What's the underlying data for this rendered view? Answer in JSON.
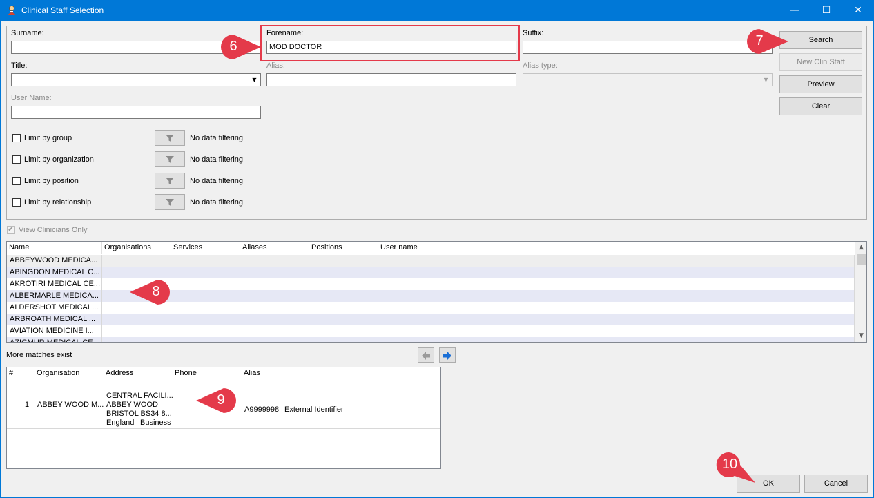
{
  "window": {
    "title": "Clinical Staff Selection",
    "minimize": "—",
    "maximize": "☐",
    "close": "✕"
  },
  "search_form": {
    "surname_label": "Surname:",
    "surname_value": "",
    "forename_label": "Forename:",
    "forename_value": "MOD DOCTOR",
    "suffix_label": "Suffix:",
    "suffix_value": "",
    "title_label": "Title:",
    "title_value": "",
    "alias_label": "Alias:",
    "alias_value": "",
    "alias_type_label": "Alias type:",
    "alias_type_value": "",
    "username_label": "User Name:",
    "username_value": "",
    "filters": [
      {
        "label": "Limit by group",
        "status": "No data filtering",
        "checked": false
      },
      {
        "label": "Limit by organization",
        "status": "No data filtering",
        "checked": false
      },
      {
        "label": "Limit by position",
        "status": "No data filtering",
        "checked": false
      },
      {
        "label": "Limit by relationship",
        "status": "No data filtering",
        "checked": false
      }
    ]
  },
  "buttons": {
    "search": "Search",
    "new_clin_staff": "New Clin Staff",
    "preview": "Preview",
    "clear": "Clear",
    "ok": "OK",
    "cancel": "Cancel"
  },
  "view_clinicians_only": {
    "label": "View Clinicians Only",
    "checked": true
  },
  "results_grid": {
    "columns": [
      "Name",
      "Organisations",
      "Services",
      "Aliases",
      "Positions",
      "User name"
    ],
    "rows": [
      [
        "ABBEYWOOD MEDICA...",
        "",
        "",
        "",
        "",
        ""
      ],
      [
        "ABINGDON MEDICAL C...",
        "",
        "",
        "",
        "",
        ""
      ],
      [
        "AKROTIRI MEDICAL CE...",
        "",
        "",
        "",
        "",
        ""
      ],
      [
        "ALBERMARLE MEDICA...",
        "",
        "",
        "",
        "",
        ""
      ],
      [
        "ALDERSHOT MEDICAL...",
        "",
        "",
        "",
        "",
        ""
      ],
      [
        "ARBROATH MEDICAL ...",
        "",
        "",
        "",
        "",
        ""
      ],
      [
        "AVIATION MEDICINE I...",
        "",
        "",
        "",
        "",
        ""
      ],
      [
        "AZIGMUR MEDICAL CE...",
        "",
        "",
        "",
        "",
        ""
      ]
    ]
  },
  "more_matches": "More matches exist",
  "detail_grid": {
    "columns": [
      "#",
      "Organisation",
      "Address",
      "Phone",
      "Alias"
    ],
    "row": {
      "num": "1",
      "organisation": "ABBEY WOOD M...",
      "address_lines": [
        "CENTRAL FACILI...",
        "ABBEY WOOD",
        "BRISTOL BS34 8..."
      ],
      "address_country": "England",
      "address_type": "Business",
      "alias_value": "A9999998",
      "alias_type": "External Identifier"
    }
  },
  "annotations": [
    "6",
    "7",
    "8",
    "9",
    "10"
  ],
  "colors": {
    "titlebar": "#0078d7",
    "badge": "#e43a4a",
    "highlight": "#e43a4a",
    "row_alt": "#e6e8f5"
  }
}
